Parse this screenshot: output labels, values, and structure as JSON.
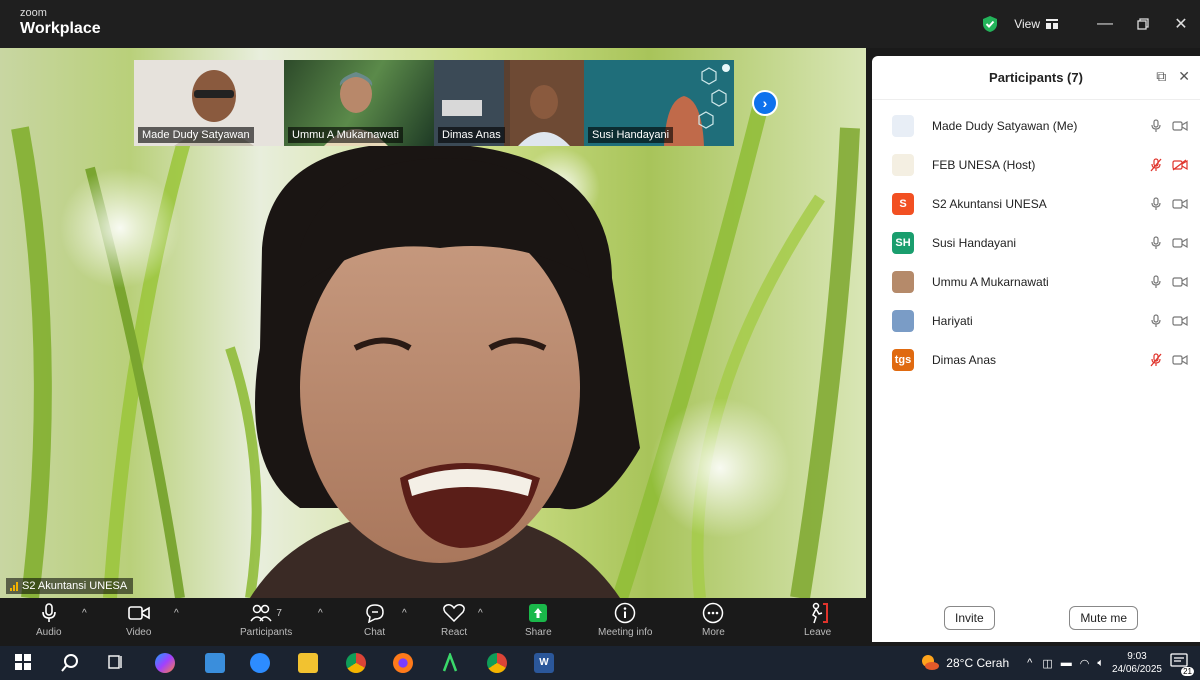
{
  "titlebar": {
    "brand_small": "zoom",
    "brand_big": "Workplace",
    "view_label": "View"
  },
  "main_video": {
    "speaker_label": "S2 Akuntansi UNESA"
  },
  "thumbnails": [
    {
      "name": "Made Dudy Satyawan"
    },
    {
      "name": "Ummu A Mukarnawati"
    },
    {
      "name": "Dimas Anas"
    },
    {
      "name": "Susi Handayani"
    }
  ],
  "participants_panel": {
    "title": "Participants (7)",
    "participants": [
      {
        "name": "Made Dudy Satyawan (Me)",
        "avatar": "",
        "avatar_color": "#e8eef6",
        "mic_muted": false,
        "video_off": false
      },
      {
        "name": "FEB UNESA (Host)",
        "avatar": "",
        "avatar_color": "#f4efe2",
        "mic_muted": true,
        "video_off": true
      },
      {
        "name": "S2 Akuntansi UNESA",
        "avatar": "S",
        "avatar_color": "#f25022",
        "mic_muted": false,
        "video_off": false
      },
      {
        "name": "Susi Handayani",
        "avatar": "SH",
        "avatar_color": "#1a9e6e",
        "mic_muted": false,
        "video_off": false
      },
      {
        "name": "Ummu A Mukarnawati",
        "avatar": "",
        "avatar_color": "#b58a6a",
        "mic_muted": false,
        "video_off": false
      },
      {
        "name": "Hariyati",
        "avatar": "",
        "avatar_color": "#7a9cc6",
        "mic_muted": false,
        "video_off": false
      },
      {
        "name": "Dimas Anas",
        "avatar": "tgs",
        "avatar_color": "#e06a10",
        "mic_muted": true,
        "video_off": false
      }
    ],
    "invite_label": "Invite",
    "mute_me_label": "Mute me"
  },
  "toolbar": {
    "audio": "Audio",
    "video": "Video",
    "participants": "Participants",
    "participants_count": "7",
    "chat": "Chat",
    "react": "React",
    "share": "Share",
    "meeting_info": "Meeting info",
    "more": "More",
    "leave": "Leave"
  },
  "taskbar": {
    "weather": "28°C  Cerah",
    "time": "9:03",
    "date": "24/06/2025",
    "notif_count": "21"
  },
  "colors": {
    "accent": "#0e72ed",
    "muted_red": "#e0342c",
    "share_green": "#1ab84a"
  }
}
